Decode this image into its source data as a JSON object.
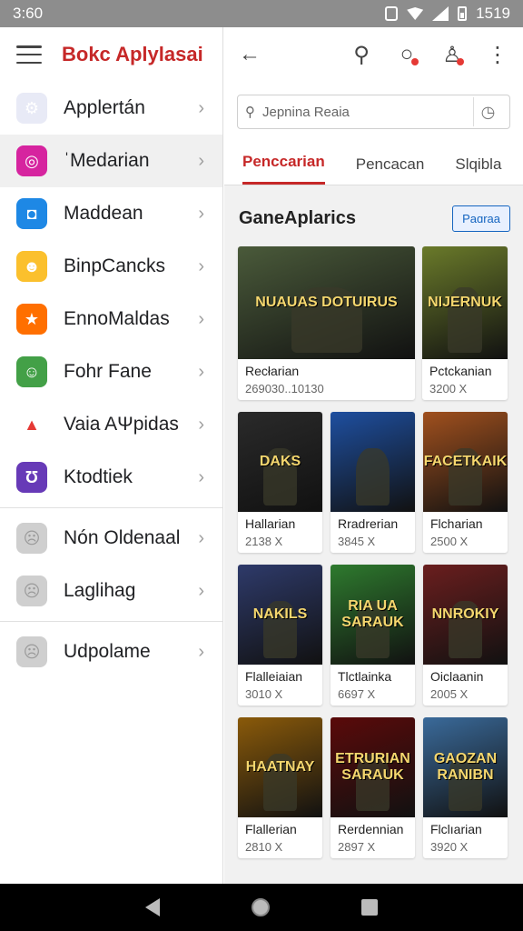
{
  "status_bar": {
    "time": "3:60",
    "clock": "1519"
  },
  "drawer": {
    "title": "Bokc Aplylasai",
    "items": [
      {
        "label": "Applertán",
        "icon": "apps-icon",
        "color": "#e8eaf6",
        "glyph": "⚙",
        "active": false
      },
      {
        "label": "ˈMedarian",
        "icon": "instagram-icon",
        "color": "#d6249f",
        "glyph": "◎",
        "active": true
      },
      {
        "label": "Maddean",
        "icon": "camera-icon",
        "color": "#1e88e5",
        "glyph": "◘",
        "active": false
      },
      {
        "label": "BinpCancks",
        "icon": "face-icon",
        "color": "#fbc02d",
        "glyph": "☻",
        "active": false
      },
      {
        "label": "EnnoMaldas",
        "icon": "star-icon",
        "color": "#ff6f00",
        "glyph": "★",
        "active": false
      },
      {
        "label": "Fohr Fane",
        "icon": "smile-icon",
        "color": "#43a047",
        "glyph": "☺",
        "active": false
      },
      {
        "label": "Vaia AΨpidas",
        "icon": "ads-icon",
        "color": "#ffffff",
        "glyph": "▲",
        "active": false
      },
      {
        "label": "Ktodtiek",
        "icon": "cup-icon",
        "color": "#673ab7",
        "glyph": "Ʊ",
        "active": false
      }
    ],
    "items_secondary": [
      {
        "label": "Nón Oldenaal",
        "icon": "placeholder-face-icon"
      },
      {
        "label": "Laglihag",
        "icon": "placeholder-face-icon"
      }
    ],
    "items_tertiary": [
      {
        "label": "Udpolame",
        "icon": "placeholder-face-icon"
      }
    ]
  },
  "search": {
    "placeholder": "Jepnina Reaia"
  },
  "tabs": [
    "Penccarian",
    "Pencacan",
    "Slqibla"
  ],
  "section": {
    "title": "GaneAplarics",
    "button": "Paɑraa"
  },
  "cards": [
    {
      "name": "Recłarian",
      "count": "269030..10130",
      "bg": "#4a5a3a",
      "art": "NUAUAS DOTUIRUS"
    },
    {
      "name": "Pctckanian",
      "count": "3200 X",
      "bg": "#6a7a2a",
      "art": "NIJERNUK"
    },
    {
      "name": "Hallarian",
      "count": "2138 X",
      "bg": "#2a2a2a",
      "art": "DAKS"
    },
    {
      "name": "Rradrerian",
      "count": "3845 X",
      "bg": "#1e4fa0",
      "art": ""
    },
    {
      "name": "Flcharian",
      "count": "2500 X",
      "bg": "#a0501e",
      "art": "FACETKAIK"
    },
    {
      "name": "Flalleiaian",
      "count": "3010 X",
      "bg": "#2e3a6a",
      "art": "NAKILS"
    },
    {
      "name": "Tlctlainka",
      "count": "6697 X",
      "bg": "#2e7a2e",
      "art": "RIA UA SARAUK"
    },
    {
      "name": "Oiclaanin",
      "count": "2005 X",
      "bg": "#6a1e1e",
      "art": "NNROKIY"
    },
    {
      "name": "Flallerian",
      "count": "2810 X",
      "bg": "#8a5a0a",
      "art": "HAATNAY"
    },
    {
      "name": "Rerdennian",
      "count": "2897 X",
      "bg": "#5a0a0a",
      "art": "ETRURIAN SARAUK"
    },
    {
      "name": "Flclıarian",
      "count": "3920 X",
      "bg": "#3a6a9a",
      "art": "GAOZAN RANIBN"
    }
  ]
}
